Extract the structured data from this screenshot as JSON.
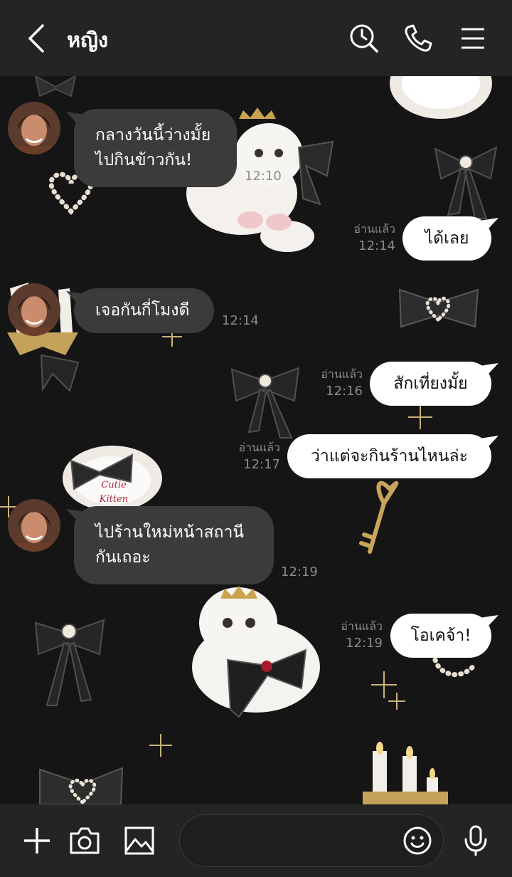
{
  "header": {
    "chat_name": "หญิง",
    "icons": [
      "back-icon",
      "clock-search-icon",
      "phone-icon",
      "menu-icon"
    ]
  },
  "messages": [
    {
      "side": "in",
      "text": "กลางวันนี้ว่างมั้ย\nไปกินข้าวกัน!",
      "time": "12:10"
    },
    {
      "side": "out",
      "text": "ได้เลย",
      "read": "อ่านแล้ว",
      "time": "12:14"
    },
    {
      "side": "in",
      "text": "เจอกันกี่โมงดี",
      "time": "12:14"
    },
    {
      "side": "out",
      "text": "สักเที่ยงมั้ย",
      "read": "อ่านแล้ว",
      "time": "12:16"
    },
    {
      "side": "out",
      "text": "ว่าแต่จะกินร้านไหนล่ะ",
      "read": "อ่านแล้ว",
      "time": "12:17"
    },
    {
      "side": "in",
      "text": "ไปร้านใหม่หน้าสถานี\nกันเถอะ",
      "time": "12:19"
    },
    {
      "side": "out",
      "text": "โอเคจ้า!",
      "read": "อ่านแล้ว",
      "time": "12:19"
    }
  ],
  "background_stickers": [
    "Cutie",
    "Kitten"
  ],
  "footer": {
    "icons": [
      "plus-icon",
      "camera-icon",
      "image-icon",
      "emoji-icon",
      "microphone-icon"
    ]
  },
  "colors": {
    "header_bg": "#242424",
    "chat_bg": "#151515",
    "bubble_in": "#3b3b3b",
    "bubble_out": "#ffffff"
  }
}
